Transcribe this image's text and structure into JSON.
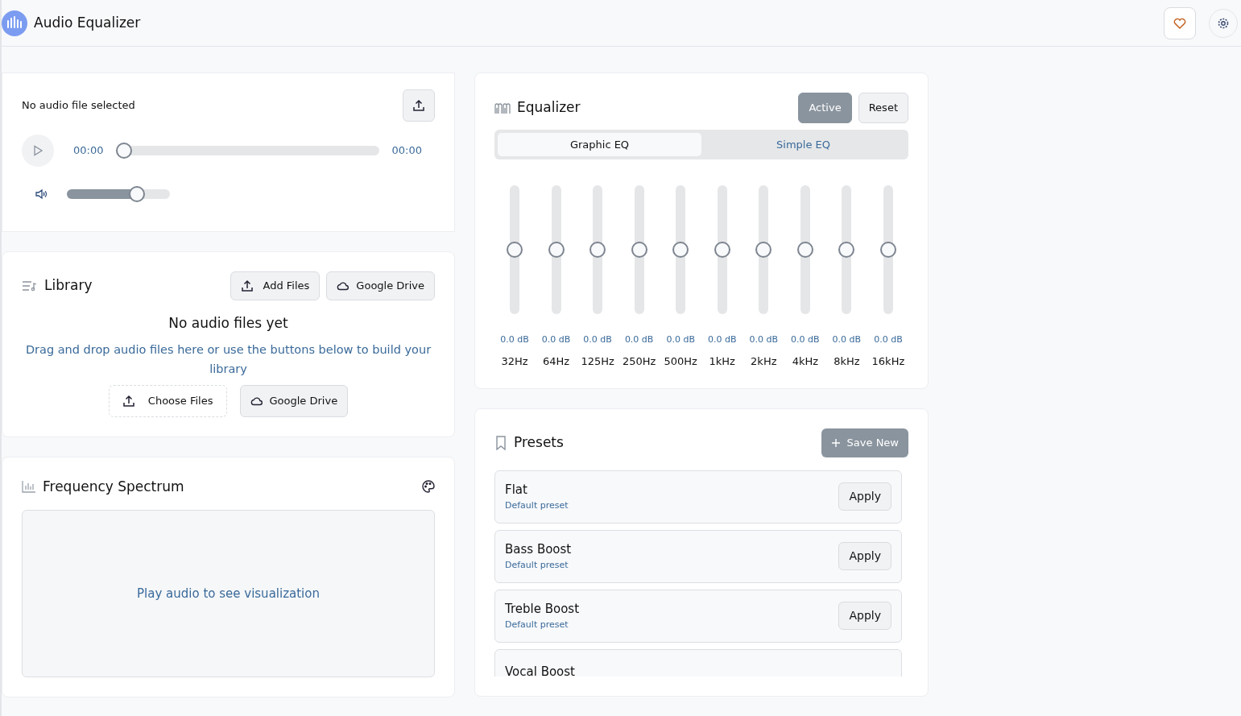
{
  "app": {
    "title": "Audio Equalizer"
  },
  "player": {
    "file_status": "No audio file selected",
    "current_time": "00:00",
    "duration": "00:00",
    "seek": {
      "level": 0
    },
    "volume": {
      "level": 0.71
    }
  },
  "library": {
    "title": "Library",
    "buttons": [
      "Add Files",
      "Google Drive"
    ],
    "empty_title": "No audio files yet",
    "empty_text": "Drag and drop audio files here or use the buttons below to build your library",
    "empty_buttons": [
      {
        "label": "Choose Files",
        "kind": "upload"
      },
      {
        "label": "Google Drive",
        "kind": "cloud"
      }
    ]
  },
  "spectrum": {
    "title": "Frequency Spectrum",
    "placeholder_text": "Play audio to see visualization"
  },
  "equalizer": {
    "title": "Equalizer",
    "active": true,
    "active_label": "Active",
    "reset_label": "Reset",
    "tabs": [
      {
        "label": "Graphic EQ",
        "selected": true
      },
      {
        "label": "Simple EQ",
        "selected": false
      }
    ],
    "bands": [
      {
        "frequency": "32Hz",
        "reading": "0.0 dB",
        "level": 0.5
      },
      {
        "frequency": "64Hz",
        "reading": "0.0 dB",
        "level": 0.5
      },
      {
        "frequency": "125Hz",
        "reading": "0.0 dB",
        "level": 0.5
      },
      {
        "frequency": "250Hz",
        "reading": "0.0 dB",
        "level": 0.5
      },
      {
        "frequency": "500Hz",
        "reading": "0.0 dB",
        "level": 0.5
      },
      {
        "frequency": "1kHz",
        "reading": "0.0 dB",
        "level": 0.5
      },
      {
        "frequency": "2kHz",
        "reading": "0.0 dB",
        "level": 0.5
      },
      {
        "frequency": "4kHz",
        "reading": "0.0 dB",
        "level": 0.5
      },
      {
        "frequency": "8kHz",
        "reading": "0.0 dB",
        "level": 0.5
      },
      {
        "frequency": "16kHz",
        "reading": "0.0 dB",
        "level": 0.5
      }
    ]
  },
  "presets": {
    "title": "Presets",
    "save_label": "Save New",
    "items": [
      {
        "name": "Flat",
        "subtitle": "Default preset",
        "action": "Apply"
      },
      {
        "name": "Bass Boost",
        "subtitle": "Default preset",
        "action": "Apply"
      },
      {
        "name": "Treble Boost",
        "subtitle": "Default preset",
        "action": "Apply"
      },
      {
        "name": "Vocal Boost"
      }
    ]
  }
}
